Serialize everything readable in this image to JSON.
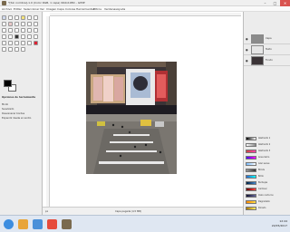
{
  "window": {
    "title": "*[Sin nombre]-1.0 (Color RGB, 1 capa) 994x1080 – GIMP",
    "controls": [
      "–",
      "□",
      "✕"
    ]
  },
  "menubar": {
    "items": [
      "Archivo",
      "Editar",
      "Seleccionar",
      "Ver",
      "Imagen",
      "Capa",
      "Colores",
      "Herramientas",
      "Filtros",
      "Ventanas",
      "Ayuda"
    ]
  },
  "toolbox": {
    "options_title": "Opciones de herramienta",
    "options_lines": [
      "Modo",
      "Suavizado",
      "Desvanecer bordes",
      "Expandir desde el centro"
    ]
  },
  "canvas": {
    "status_coords": "px",
    "status_info": "Capa pegada (4,5 MB)"
  },
  "layers": {
    "items": [
      {
        "name": "Capa"
      },
      {
        "name": "Texto"
      },
      {
        "name": "Fondo"
      }
    ]
  },
  "gradients": {
    "items": [
      "Abstracto 1",
      "Abstracto 2",
      "Abstracto 3",
      "Aneurismo",
      "Azul suave",
      "Blinds",
      "Brillo",
      "Burbujas",
      "Carmesí",
      "Cielo nocturno",
      "Degradado",
      "Dorado"
    ]
  },
  "taskbar": {
    "time": "12:44",
    "date": "22/05/2017"
  },
  "colors": {
    "accent_close": "#d9534f",
    "taskbar": "#dfe7f2"
  }
}
